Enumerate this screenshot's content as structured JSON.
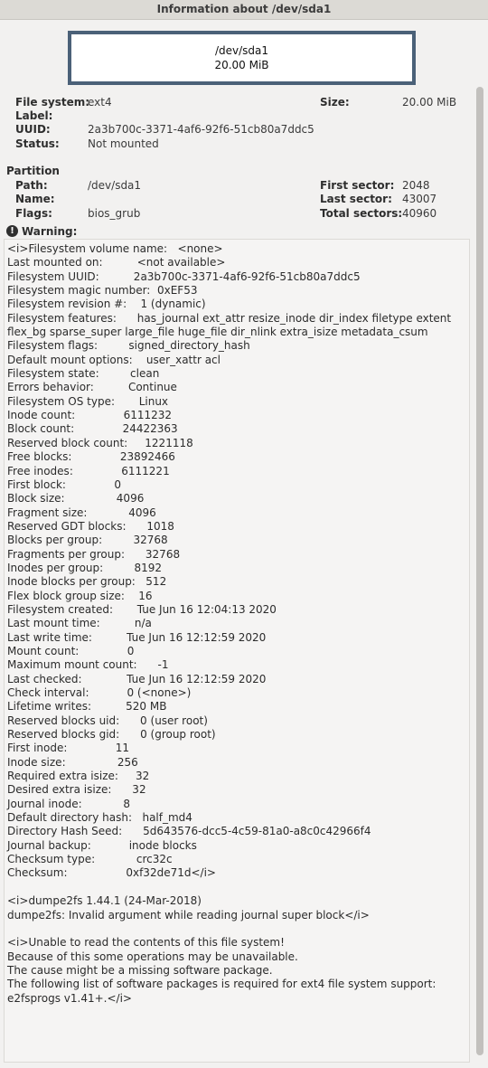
{
  "window": {
    "title": "Information about /dev/sda1"
  },
  "partition_graphic": {
    "name": "/dev/sda1",
    "size": "20.00 MiB"
  },
  "filesystem": {
    "fs_label": "File system:",
    "fs_value": "ext4",
    "label_label": "Label:",
    "label_value": "",
    "uuid_label": "UUID:",
    "uuid_value": "2a3b700c-3371-4af6-92f6-51cb80a7ddc5",
    "status_label": "Status:",
    "status_value": "Not mounted",
    "size_label": "Size:",
    "size_value": "20.00 MiB"
  },
  "partition": {
    "heading": "Partition",
    "path_label": "Path:",
    "path_value": "/dev/sda1",
    "name_label": "Name:",
    "name_value": "",
    "flags_label": "Flags:",
    "flags_value": "bios_grub",
    "first_sector_label": "First sector:",
    "first_sector_value": "2048",
    "last_sector_label": "Last sector:",
    "last_sector_value": "43007",
    "total_sectors_label": "Total sectors:",
    "total_sectors_value": "40960"
  },
  "warning": {
    "icon": "exclamation-icon",
    "heading": "Warning:",
    "message": "<i>Filesystem volume name:   <none>\nLast mounted on:          <not available>\nFilesystem UUID:          2a3b700c-3371-4af6-92f6-51cb80a7ddc5\nFilesystem magic number:  0xEF53\nFilesystem revision #:    1 (dynamic)\nFilesystem features:      has_journal ext_attr resize_inode dir_index filetype extent flex_bg sparse_super large_file huge_file dir_nlink extra_isize metadata_csum\nFilesystem flags:         signed_directory_hash \nDefault mount options:    user_xattr acl\nFilesystem state:         clean\nErrors behavior:          Continue\nFilesystem OS type:       Linux\nInode count:              6111232\nBlock count:              24422363\nReserved block count:     1221118\nFree blocks:              23892466\nFree inodes:              6111221\nFirst block:              0\nBlock size:               4096\nFragment size:            4096\nReserved GDT blocks:      1018\nBlocks per group:         32768\nFragments per group:      32768\nInodes per group:         8192\nInode blocks per group:   512\nFlex block group size:    16\nFilesystem created:       Tue Jun 16 12:04:13 2020\nLast mount time:          n/a\nLast write time:          Tue Jun 16 12:12:59 2020\nMount count:              0\nMaximum mount count:      -1\nLast checked:             Tue Jun 16 12:12:59 2020\nCheck interval:           0 (<none>)\nLifetime writes:          520 MB\nReserved blocks uid:      0 (user root)\nReserved blocks gid:      0 (group root)\nFirst inode:              11\nInode size:               256\nRequired extra isize:     32\nDesired extra isize:      32\nJournal inode:            8\nDefault directory hash:   half_md4\nDirectory Hash Seed:      5d643576-dcc5-4c59-81a0-a8c0c42966f4\nJournal backup:           inode blocks\nChecksum type:            crc32c\nChecksum:                 0xf32de71d</i>\n\n<i>dumpe2fs 1.44.1 (24-Mar-2018)\ndumpe2fs: Invalid argument while reading journal super block</i>\n\n<i>Unable to read the contents of this file system!\nBecause of this some operations may be unavailable.\nThe cause might be a missing software package.\nThe following list of software packages is required for ext4 file system support:  e2fsprogs v1.41+.</i>"
  }
}
